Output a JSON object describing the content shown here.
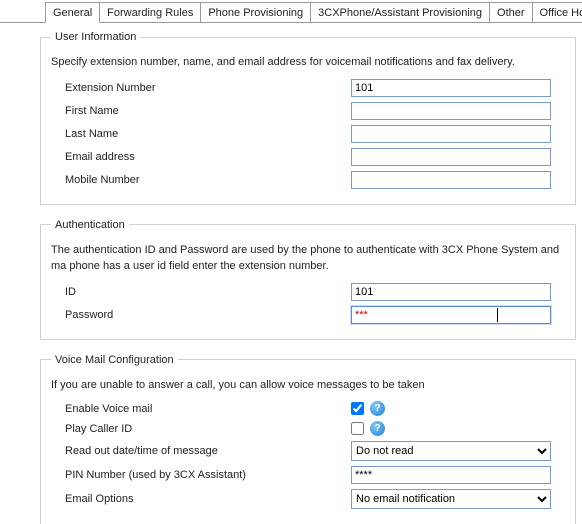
{
  "tabs": {
    "general": "General",
    "forwarding": "Forwarding Rules",
    "provisioning": "Phone Provisioning",
    "assistant": "3CXPhone/Assistant Provisioning",
    "other": "Other",
    "office": "Office Hours"
  },
  "userInfo": {
    "legend": "User Information",
    "desc": "Specify extension number, name, and email address for voicemail notifications and fax delivery.",
    "extLabel": "Extension Number",
    "extValue": "101",
    "firstLabel": "First Name",
    "firstValue": "",
    "lastLabel": "Last Name",
    "lastValue": "",
    "emailLabel": "Email address",
    "emailValue": "",
    "mobileLabel": "Mobile Number",
    "mobileValue": ""
  },
  "auth": {
    "legend": "Authentication",
    "desc": "The authentication ID and Password are used by the phone to authenticate with 3CX Phone System and ma phone has a user id field enter the extension number.",
    "idLabel": "ID",
    "idValue": "101",
    "pwLabel": "Password",
    "pwValue": "***"
  },
  "vm": {
    "legend": "Voice Mail Configuration",
    "desc": "If you are unable to answer a call, you can allow voice messages to be taken",
    "enableLabel": "Enable Voice mail",
    "enableChecked": true,
    "playLabel": "Play Caller ID",
    "playChecked": false,
    "readLabel": "Read out date/time of message",
    "readSelected": "Do not read",
    "readOptions": [
      "Do not read"
    ],
    "pinLabel": "PIN Number (used by 3CX Assistant)",
    "pinValue": "****",
    "emailLabel": "Email Options",
    "emailSelected": "No email notification",
    "emailOptions": [
      "No email notification"
    ],
    "helpGlyph": "?"
  }
}
